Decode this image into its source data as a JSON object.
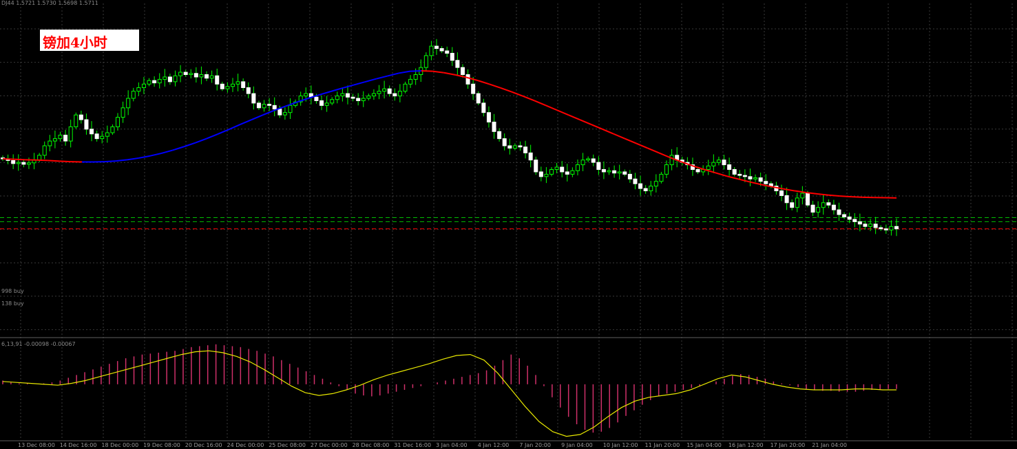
{
  "chart_data": {
    "type": "candlestick",
    "symbol_info": "DJ44  1.5721 1.5730 1.5698 1.5711",
    "annotation": "镑加4小时",
    "order_labels": [
      "998 buy",
      "138 buy"
    ],
    "indicator_info": "6,13,91  -0.00098 -0.00067",
    "x_ticks": [
      "13 Dec 08:00",
      "14 Dec 16:00",
      "18 Dec 00:00",
      "19 Dec 08:00",
      "20 Dec 16:00",
      "24 Dec 00:00",
      "25 Dec 08:00",
      "27 Dec 00:00",
      "28 Dec 08:00",
      "31 Dec 16:00",
      "3 Jan 04:00",
      "4 Jan 12:00",
      "7 Jan 20:00",
      "9 Jan 04:00",
      "10 Jan 12:00",
      "11 Jan 20:00",
      "15 Jan 04:00",
      "16 Jan 12:00",
      "17 Jan 20:00",
      "21 Jan 04:00"
    ],
    "y_range": [
      1.45,
      1.59
    ],
    "price_close": [
      1.5245,
      1.5238,
      1.5225,
      1.523,
      1.5222,
      1.5228,
      1.524,
      1.526,
      1.53,
      1.532,
      1.533,
      1.5345,
      1.532,
      1.538,
      1.543,
      1.541,
      1.537,
      1.535,
      1.533,
      1.534,
      1.5355,
      1.538,
      1.542,
      1.546,
      1.55,
      1.553,
      1.5545,
      1.556,
      1.5575,
      1.5565,
      1.558,
      1.559,
      1.557,
      1.5595,
      1.561,
      1.56,
      1.5605,
      1.559,
      1.56,
      1.5585,
      1.5595,
      1.556,
      1.554,
      1.555,
      1.556,
      1.557,
      1.5545,
      1.552,
      1.548,
      1.546,
      1.5475,
      1.547,
      1.5455,
      1.543,
      1.544,
      1.547,
      1.5485,
      1.551,
      1.552,
      1.5505,
      1.549,
      1.547,
      1.548,
      1.5495,
      1.551,
      1.552,
      1.5505,
      1.55,
      1.549,
      1.55,
      1.551,
      1.552,
      1.553,
      1.554,
      1.552,
      1.551,
      1.553,
      1.556,
      1.558,
      1.56,
      1.563,
      1.568,
      1.572,
      1.571,
      1.57,
      1.569,
      1.566,
      1.563,
      1.56,
      1.556,
      1.552,
      1.548,
      1.544,
      1.54,
      1.536,
      1.533,
      1.53,
      1.529,
      1.53,
      1.5295,
      1.527,
      1.524,
      1.519,
      1.517,
      1.518,
      1.52,
      1.521,
      1.519,
      1.518,
      1.5195,
      1.522,
      1.524,
      1.5245,
      1.523,
      1.52,
      1.519,
      1.5195,
      1.5185,
      1.519,
      1.518,
      1.516,
      1.514,
      1.512,
      1.511,
      1.513,
      1.515,
      1.518,
      1.522,
      1.526,
      1.524,
      1.523,
      1.522,
      1.52,
      1.519,
      1.52,
      1.5215,
      1.523,
      1.524,
      1.522,
      1.52,
      1.518,
      1.5175,
      1.517,
      1.516,
      1.5165,
      1.515,
      1.514,
      1.513,
      1.511,
      1.509,
      1.506,
      1.504,
      1.508,
      1.51,
      1.505,
      1.502,
      1.504,
      1.506,
      1.505,
      1.503,
      1.501,
      1.5,
      1.499,
      1.498,
      1.497,
      1.496,
      1.497,
      1.4955,
      1.495,
      1.4945,
      1.496,
      1.495
    ],
    "ma": {
      "values": [
        1.5245,
        1.5243,
        1.5241,
        1.524,
        1.5238,
        1.5235,
        1.5233,
        1.5232,
        1.5232,
        1.5233,
        1.5236,
        1.5241,
        1.5248,
        1.5257,
        1.5268,
        1.5281,
        1.5296,
        1.5312,
        1.533,
        1.5349,
        1.5369,
        1.539,
        1.541,
        1.543,
        1.5449,
        1.5467,
        1.5484,
        1.55,
        1.5515,
        1.5529,
        1.5543,
        1.5556,
        1.5569,
        1.5582,
        1.5594,
        1.5606,
        1.5614,
        1.5616,
        1.5614,
        1.5608,
        1.5599,
        1.5588,
        1.5575,
        1.556,
        1.5544,
        1.5527,
        1.5509,
        1.549,
        1.547,
        1.545,
        1.543,
        1.541,
        1.539,
        1.537,
        1.535,
        1.533,
        1.531,
        1.529,
        1.527,
        1.525,
        1.5232,
        1.5215,
        1.52,
        1.5186,
        1.5172,
        1.516,
        1.5148,
        1.5137,
        1.5127,
        1.5118,
        1.511,
        1.5103,
        1.5097,
        1.5092,
        1.5088,
        1.5085,
        1.5083,
        1.5082,
        1.5081,
        1.508
      ],
      "rising_color": "#0000ff",
      "falling_color": "#ff0000"
    },
    "order_lines": [
      {
        "price": 1.4997,
        "color": "#00c000"
      },
      {
        "price": 1.498,
        "color": "#00c000"
      },
      {
        "price": 1.495,
        "color": "#ff0000"
      }
    ],
    "macd_range": [
      -0.006,
      0.0048
    ],
    "macd_hist": [
      0.0004,
      0.0002,
      0.0001,
      0.0001,
      0.0,
      0.0001,
      0.0002,
      0.0004,
      0.0007,
      0.001,
      0.0013,
      0.0016,
      0.0019,
      0.0022,
      0.0025,
      0.0028,
      0.003,
      0.0032,
      0.0033,
      0.0034,
      0.0035,
      0.0036,
      0.0038,
      0.004,
      0.0041,
      0.0042,
      0.0043,
      0.0042,
      0.0041,
      0.004,
      0.0038,
      0.0036,
      0.0033,
      0.003,
      0.0026,
      0.0022,
      0.0018,
      0.0014,
      0.001,
      0.0006,
      0.0002,
      -0.0002,
      -0.0006,
      -0.001,
      -0.0012,
      -0.0013,
      -0.0012,
      -0.001,
      -0.0008,
      -0.0006,
      -0.0004,
      -0.0002,
      0.0,
      0.0002,
      0.0004,
      0.0006,
      0.0008,
      0.001,
      0.0012,
      0.0015,
      0.002,
      0.0026,
      0.0032,
      0.0028,
      0.002,
      0.001,
      -0.0002,
      -0.0014,
      -0.0025,
      -0.0035,
      -0.0043,
      -0.0049,
      -0.0052,
      -0.0051,
      -0.0047,
      -0.0041,
      -0.0034,
      -0.0028,
      -0.0022,
      -0.0017,
      -0.0013,
      -0.001,
      -0.0008,
      -0.0006,
      -0.0004,
      -0.0002,
      0.0,
      0.0003,
      0.0006,
      0.0009,
      0.0011,
      0.001,
      0.0008,
      0.0006,
      0.0003,
      0.0001,
      -0.0001,
      -0.0003,
      -0.0005,
      -0.0006,
      -0.0007,
      -0.0007,
      -0.0008,
      -0.0008,
      -0.0008,
      -0.0007,
      -0.0006,
      -0.0006,
      -0.0005,
      -0.0005
    ],
    "macd_signal": [
      0.0003,
      0.0002,
      0.0001,
      0.0,
      -0.0001,
      0.0001,
      0.0004,
      0.0008,
      0.0012,
      0.0016,
      0.002,
      0.0024,
      0.0028,
      0.0032,
      0.0035,
      0.0036,
      0.0034,
      0.003,
      0.0024,
      0.0016,
      0.0007,
      -0.0002,
      -0.0009,
      -0.0012,
      -0.001,
      -0.0006,
      -0.0001,
      0.0005,
      0.001,
      0.0014,
      0.0018,
      0.0022,
      0.0027,
      0.0031,
      0.0032,
      0.0026,
      0.0012,
      -0.0006,
      -0.0024,
      -0.004,
      -0.0051,
      -0.0056,
      -0.0054,
      -0.0046,
      -0.0035,
      -0.0025,
      -0.0018,
      -0.0014,
      -0.0012,
      -0.001,
      -0.0006,
      0.0,
      0.0006,
      0.001,
      0.0008,
      0.0004,
      0.0,
      -0.0003,
      -0.0005,
      -0.0006,
      -0.0006,
      -0.0006,
      -0.0005,
      -0.0005,
      -0.0006,
      -0.0006
    ]
  }
}
